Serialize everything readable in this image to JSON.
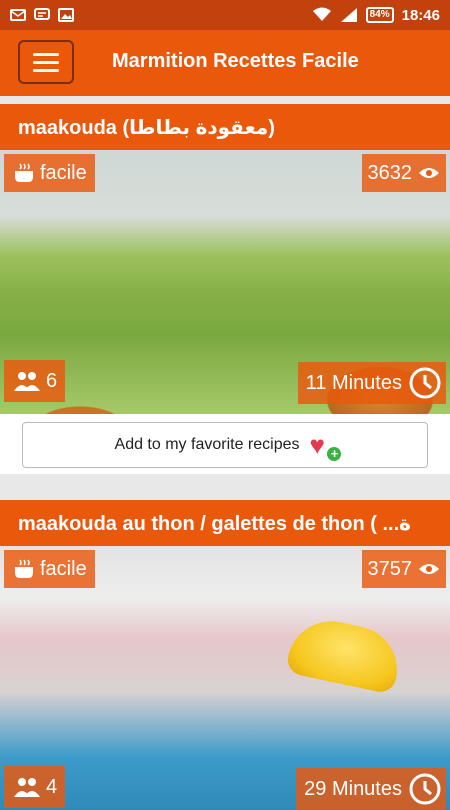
{
  "status_bar": {
    "battery": "84%",
    "time": "18:46"
  },
  "app_bar": {
    "title": "Marmition Recettes Facile",
    "menu_icon": "hamburger-icon"
  },
  "colors": {
    "primary": "#ea580c",
    "status": "#c2410c",
    "favorite_heart": "#e53950",
    "favorite_plus": "#3cb043"
  },
  "recipes": [
    {
      "title": "maakouda (معقودة بطاطا)",
      "difficulty": "facile",
      "views": "3632",
      "persons": "6",
      "time": "11 Minutes",
      "favorite_label": "Add to my favorite recipes"
    },
    {
      "title": "maakouda au thon / galettes de thon ( ...ة",
      "difficulty": "facile",
      "views": "3757",
      "persons": "4",
      "time": "29 Minutes"
    }
  ]
}
